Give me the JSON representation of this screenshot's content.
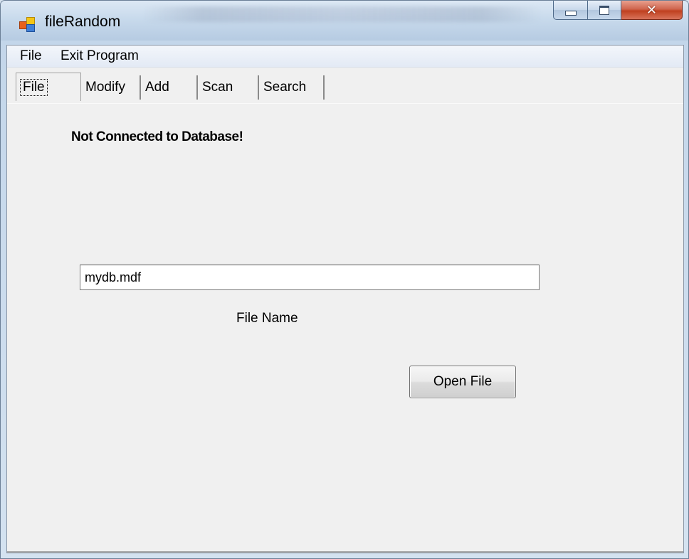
{
  "window": {
    "title": "fileRandom"
  },
  "menubar": {
    "items": [
      {
        "label": "File"
      },
      {
        "label": "Exit Program"
      }
    ]
  },
  "tabs": [
    {
      "label": "File",
      "active": true
    },
    {
      "label": "Modify",
      "active": false
    },
    {
      "label": "Add",
      "active": false
    },
    {
      "label": "Scan",
      "active": false
    },
    {
      "label": "Search",
      "active": false
    }
  ],
  "main": {
    "status_text": "Not Connected to Database!",
    "filename_value": "mydb.mdf",
    "filename_label": "File Name",
    "open_button_label": "Open File"
  },
  "icons": {
    "app": "app-window-icon",
    "minimize": "minimize-icon",
    "maximize": "maximize-icon",
    "close": "close-icon"
  },
  "colors": {
    "client_background": "#f0f0f0",
    "close_button": "#c7422a"
  }
}
